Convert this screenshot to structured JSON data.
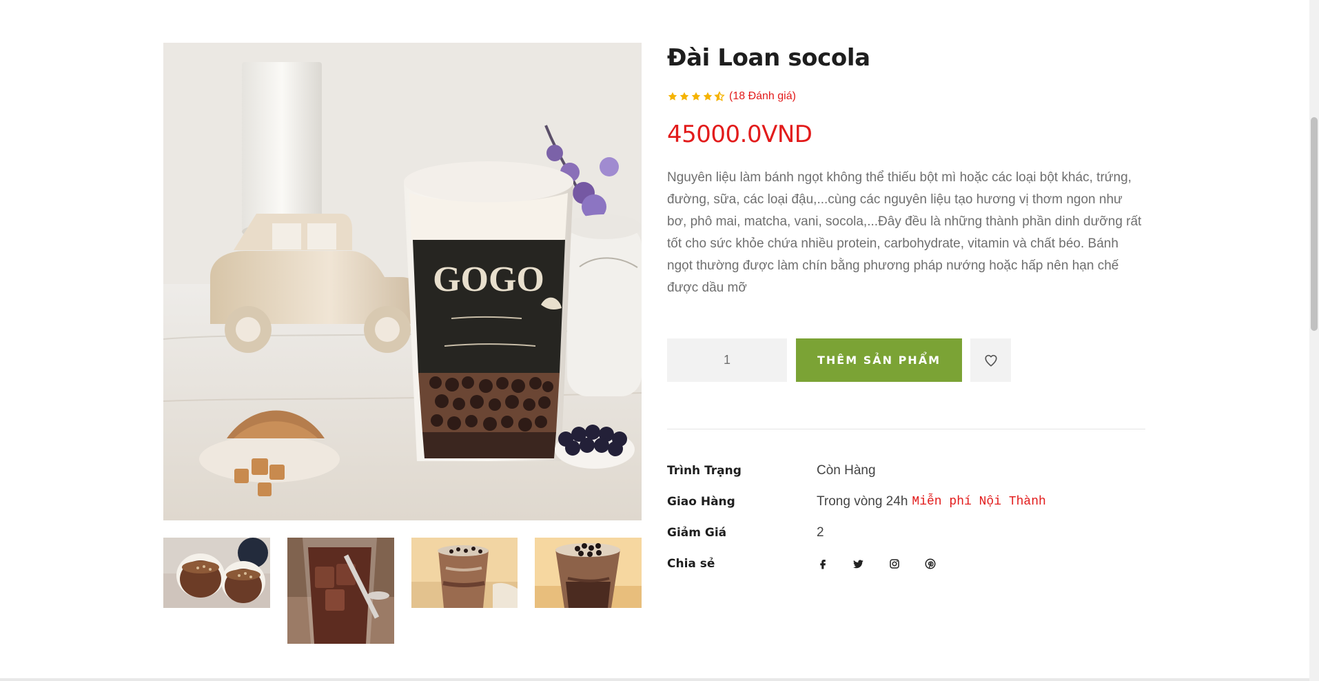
{
  "product": {
    "title": "Đài Loan socola",
    "rating_value": 4.5,
    "rating_text": "(18 Đánh giá)",
    "price": "45000.0VND",
    "description": "Nguyên liệu làm bánh ngọt không thể thiếu bột mì hoặc các loại bột khác, trứng, đường, sữa, các loại đậu,...cùng các nguyên liệu tạo hương vị thơm ngon như bơ, phô mai, matcha, vani, socola,...Đây đều là những thành phần dinh dưỡng rất tốt cho sức khỏe chứa nhiều protein, carbohydrate, vitamin và chất béo. Bánh ngọt thường được làm chín bằng phương pháp nướng hoặc hấp nên hạn chế được dầu mỡ",
    "quantity": "1",
    "add_button_label": "THÊM SẢN PHẨM"
  },
  "details": {
    "status_label": "Trình Trạng",
    "status_value": "Còn Hàng",
    "shipping_label": "Giao Hàng",
    "shipping_value": "Trong vòng 24h",
    "shipping_note": "Miễn phí Nội Thành",
    "discount_label": "Giảm Giá",
    "discount_value": "2",
    "share_label": "Chia sẻ"
  },
  "gallery": {
    "main_cup_brand": "GOGO",
    "thumbnails": [
      "thumbnail-chocolate-pudding",
      "thumbnail-iced-chocolate",
      "thumbnail-chocolate-milk-tea",
      "thumbnail-chocolate-pudding-tea"
    ]
  },
  "social_icons": [
    "facebook-icon",
    "twitter-icon",
    "instagram-icon",
    "pinterest-icon"
  ],
  "colors": {
    "accent_red": "#e21b1b",
    "button_green": "#7ba335",
    "star_yellow": "#f5b301",
    "text_dark": "#1e1e1e",
    "text_muted": "#6f6f6f"
  }
}
